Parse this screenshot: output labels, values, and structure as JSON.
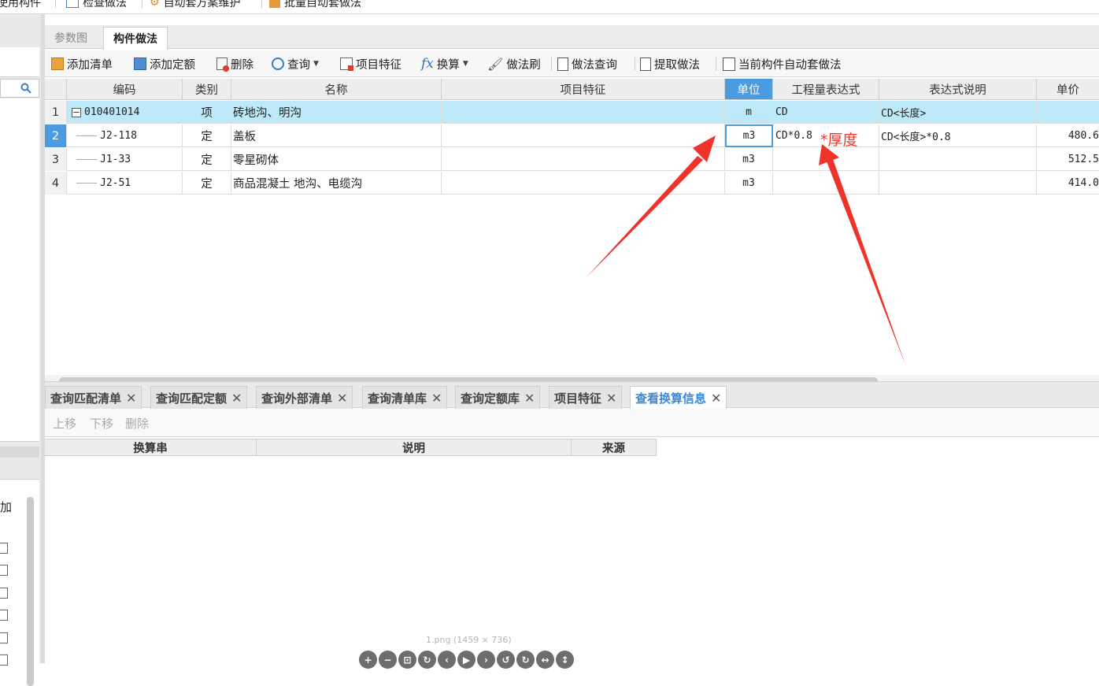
{
  "toolbar_top": {
    "items": [
      "使用构件",
      "检查做法",
      "自动套方案维护",
      "批量自动套做法"
    ]
  },
  "top_tabs": [
    "参数图",
    "构件做法"
  ],
  "toolbar": {
    "add_list": "添加清单",
    "add_quota": "添加定额",
    "delete": "删除",
    "query": "查询",
    "project_feature": "项目特征",
    "convert": "换算",
    "method_brush": "做法刷",
    "method_query": "做法查询",
    "extract_method": "提取做法",
    "auto_apply": "当前构件自动套做法"
  },
  "grid": {
    "headers": [
      "编码",
      "类别",
      "名称",
      "项目特征",
      "单位",
      "工程量表达式",
      "表达式说明",
      "单价"
    ],
    "rows": [
      {
        "num": "1",
        "code": "010401014",
        "type": "项",
        "name": "砖地沟、明沟",
        "feature": "",
        "unit": "m",
        "expr": "CD",
        "desc": "CD<长度>",
        "price": ""
      },
      {
        "num": "2",
        "code": "J2-118",
        "type": "定",
        "name": "盖板",
        "feature": "",
        "unit": "m3",
        "expr": "CD*0.8",
        "desc": "CD<长度>*0.8",
        "price": "480.6"
      },
      {
        "num": "3",
        "code": "J1-33",
        "type": "定",
        "name": "零星砌体",
        "feature": "",
        "unit": "m3",
        "expr": "",
        "desc": "",
        "price": "512.5"
      },
      {
        "num": "4",
        "code": "J2-51",
        "type": "定",
        "name": "商品混凝土 地沟、电缆沟",
        "feature": "",
        "unit": "m3",
        "expr": "",
        "desc": "",
        "price": "414.0"
      }
    ]
  },
  "annotation": {
    "text": "*厚度",
    "color": "#e8392e"
  },
  "bottom_tabs": [
    "查询匹配清单",
    "查询匹配定额",
    "查询外部清单",
    "查询清单库",
    "查询定额库",
    "项目特征",
    "查看换算信息"
  ],
  "bottom_toolbar": [
    "上移",
    "下移",
    "删除"
  ],
  "bottom_grid": {
    "headers": [
      "换算串",
      "说明",
      "来源"
    ]
  },
  "left_panel": {
    "label": "加"
  },
  "viewer": {
    "file_label": "1.png (1459 × 736)"
  },
  "colors": {
    "accent": "#4b9be0",
    "selected_row": "#bde9f9",
    "arrow": "#f0332a"
  }
}
